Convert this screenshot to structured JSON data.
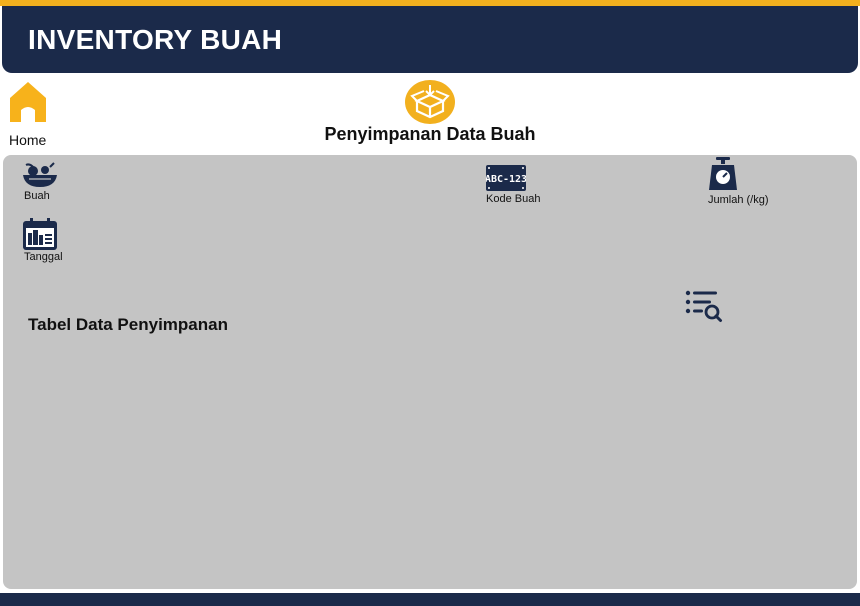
{
  "header": {
    "title": "INVENTORY BUAH"
  },
  "nav": {
    "home_label": "Home",
    "home_icon": "home-icon"
  },
  "page": {
    "title": "Penyimpanan Data Buah",
    "icon": "open-box-icon"
  },
  "form": {
    "fields": [
      {
        "label": "Buah",
        "icon": "fruit-bowl-icon"
      },
      {
        "label": "Kode Buah",
        "icon": "code-plate-icon",
        "icon_text": "ABC-123"
      },
      {
        "label": "Jumlah (/kg)",
        "icon": "weight-scale-icon"
      },
      {
        "label": "Tanggal",
        "icon": "calendar-icon"
      }
    ]
  },
  "table": {
    "title": "Tabel Data Penyimpanan",
    "search_icon": "list-search-icon"
  },
  "colors": {
    "navy": "#1b2a4a",
    "accent": "#f2b01e",
    "panel": "#c4c4c4"
  }
}
